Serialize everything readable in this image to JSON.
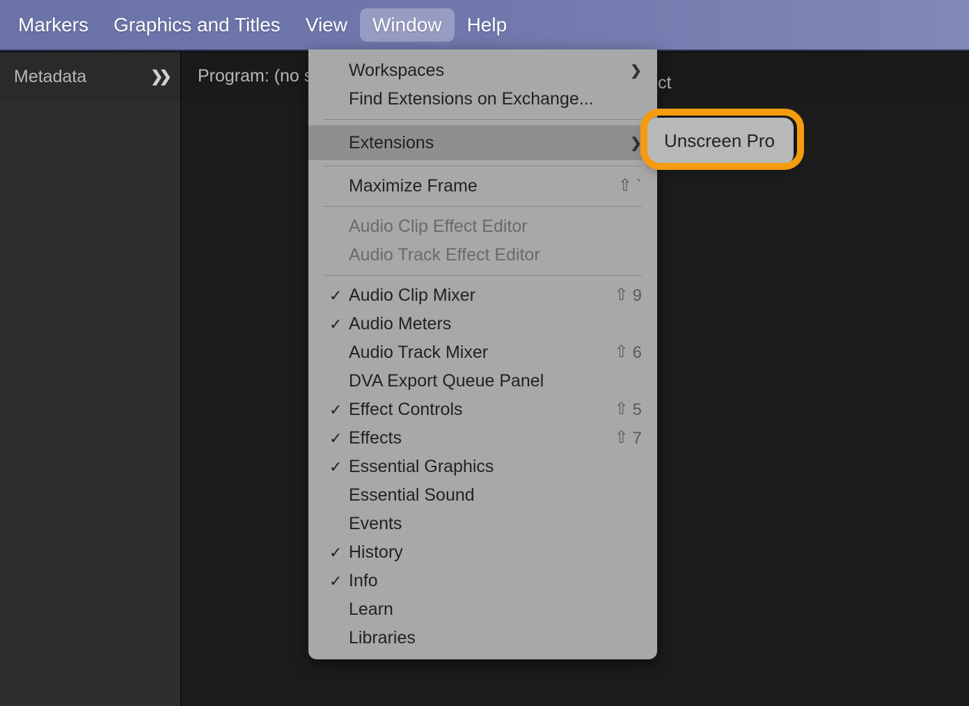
{
  "menubar": {
    "items": [
      "Markers",
      "Graphics and Titles",
      "View",
      "Window",
      "Help"
    ],
    "active_index": 3
  },
  "tabs": {
    "metadata_label": "Metadata",
    "program_label": "Program: (no sequ",
    "right_peek": "ct"
  },
  "dropdown": {
    "groups": [
      [
        {
          "label": "Workspaces",
          "submenu": true
        },
        {
          "label": "Find Extensions on Exchange..."
        }
      ],
      [
        {
          "label": "Extensions",
          "submenu": true,
          "highlight": true
        }
      ],
      [
        {
          "label": "Maximize Frame",
          "shortcut_shift": true,
          "shortcut_key": "`"
        }
      ],
      [
        {
          "label": "Audio Clip Effect Editor",
          "disabled": true
        },
        {
          "label": "Audio Track Effect Editor",
          "disabled": true
        }
      ],
      [
        {
          "label": "Audio Clip Mixer",
          "checked": true,
          "shortcut_shift": true,
          "shortcut_key": "9"
        },
        {
          "label": "Audio Meters",
          "checked": true
        },
        {
          "label": "Audio Track Mixer",
          "shortcut_shift": true,
          "shortcut_key": "6"
        },
        {
          "label": "DVA Export Queue Panel"
        },
        {
          "label": "Effect Controls",
          "checked": true,
          "shortcut_shift": true,
          "shortcut_key": "5"
        },
        {
          "label": "Effects",
          "checked": true,
          "shortcut_shift": true,
          "shortcut_key": "7"
        },
        {
          "label": "Essential Graphics",
          "checked": true
        },
        {
          "label": "Essential Sound"
        },
        {
          "label": "Events"
        },
        {
          "label": "History",
          "checked": true
        },
        {
          "label": "Info",
          "checked": true
        },
        {
          "label": "Learn"
        },
        {
          "label": "Libraries"
        }
      ]
    ]
  },
  "submenu": {
    "items": [
      {
        "label": "Unscreen Pro"
      }
    ]
  }
}
